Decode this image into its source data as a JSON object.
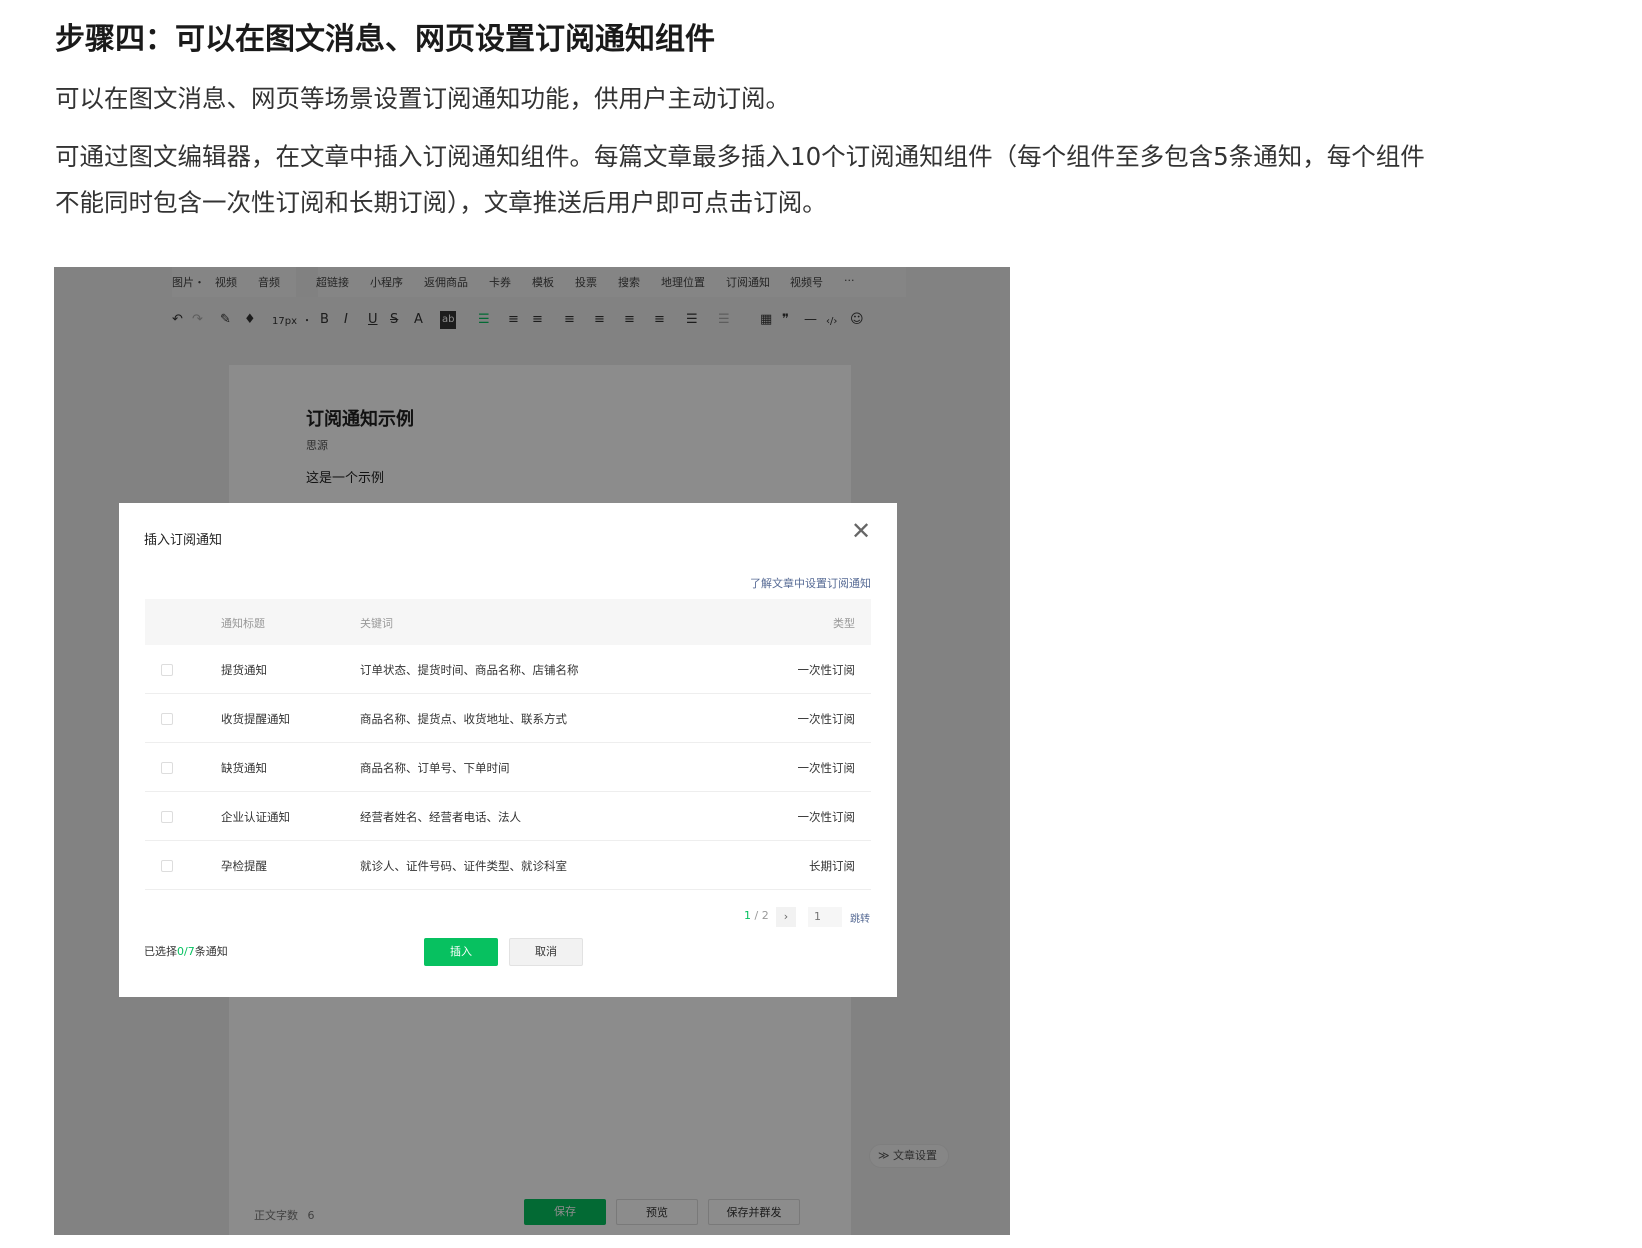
{
  "heading": "步骤四：可以在图文消息、网页设置订阅通知组件",
  "paragraph1": "可以在图文消息、网页等场景设置订阅通知功能，供用户主动订阅。",
  "paragraph2_line1": "可通过图文编辑器，在文章中插入订阅通知组件。每篇文章最多插入10个订阅通知组件（每个组件至多包含5条通知，每个组件",
  "paragraph2_line2": "不能同时包含一次性订阅和长期订阅），文章推送后用户即可点击订阅。",
  "editor": {
    "menu": [
      "图片・",
      "视频",
      "音频",
      "超链接",
      "小程序",
      "返佣商品",
      "卡券",
      "模板",
      "投票",
      "搜索",
      "地理位置",
      "订阅通知",
      "视频号",
      "···"
    ],
    "toolbar": {
      "undo": "↶",
      "redo": "↷",
      "format_painter": "✎",
      "clear": "♦",
      "font_size": "17px",
      "font_size_arrow": "・",
      "bold": "B",
      "italic": "I",
      "underline": "U",
      "strike": "S",
      "font_color": "A",
      "bg_color": "ab",
      "align": "☰",
      "indent": "≡",
      "quote": "❞",
      "hr": "—",
      "code": "‹/›",
      "emoji": "☺",
      "table": "▦"
    },
    "article": {
      "title": "订阅通知示例",
      "author": "思源",
      "body": "这是一个示例"
    },
    "settings_label": "≫ 文章设置",
    "word_count_label": "正文字数",
    "word_count": "6",
    "save_label": "保存",
    "preview_label": "预览",
    "publish_label": "保存并群发"
  },
  "dialog": {
    "title": "插入订阅通知",
    "close": "✕",
    "help_link": "了解文章中设置订阅通知",
    "columns": {
      "title": "通知标题",
      "keywords": "关键词",
      "type": "类型"
    },
    "rows": [
      {
        "title": "提货通知",
        "keywords": "订单状态、提货时间、商品名称、店铺名称",
        "type": "一次性订阅"
      },
      {
        "title": "收货提醒通知",
        "keywords": "商品名称、提货点、收货地址、联系方式",
        "type": "一次性订阅"
      },
      {
        "title": "缺货通知",
        "keywords": "商品名称、订单号、下单时间",
        "type": "一次性订阅"
      },
      {
        "title": "企业认证通知",
        "keywords": "经营者姓名、经营者电话、法人",
        "type": "一次性订阅"
      },
      {
        "title": "孕检提醒",
        "keywords": "就诊人、证件号码、证件类型、就诊科室",
        "type": "长期订阅"
      }
    ],
    "pager": {
      "current": "1",
      "separator": "/",
      "total": "2",
      "next": "›",
      "input_placeholder": "1",
      "jump_label": "跳转"
    },
    "selected_prefix": "已选择",
    "selected_count": "0/7",
    "selected_suffix": "条通知",
    "insert_label": "插入",
    "cancel_label": "取消"
  },
  "colors": {
    "accent": "#07c160",
    "link": "#576b95"
  }
}
